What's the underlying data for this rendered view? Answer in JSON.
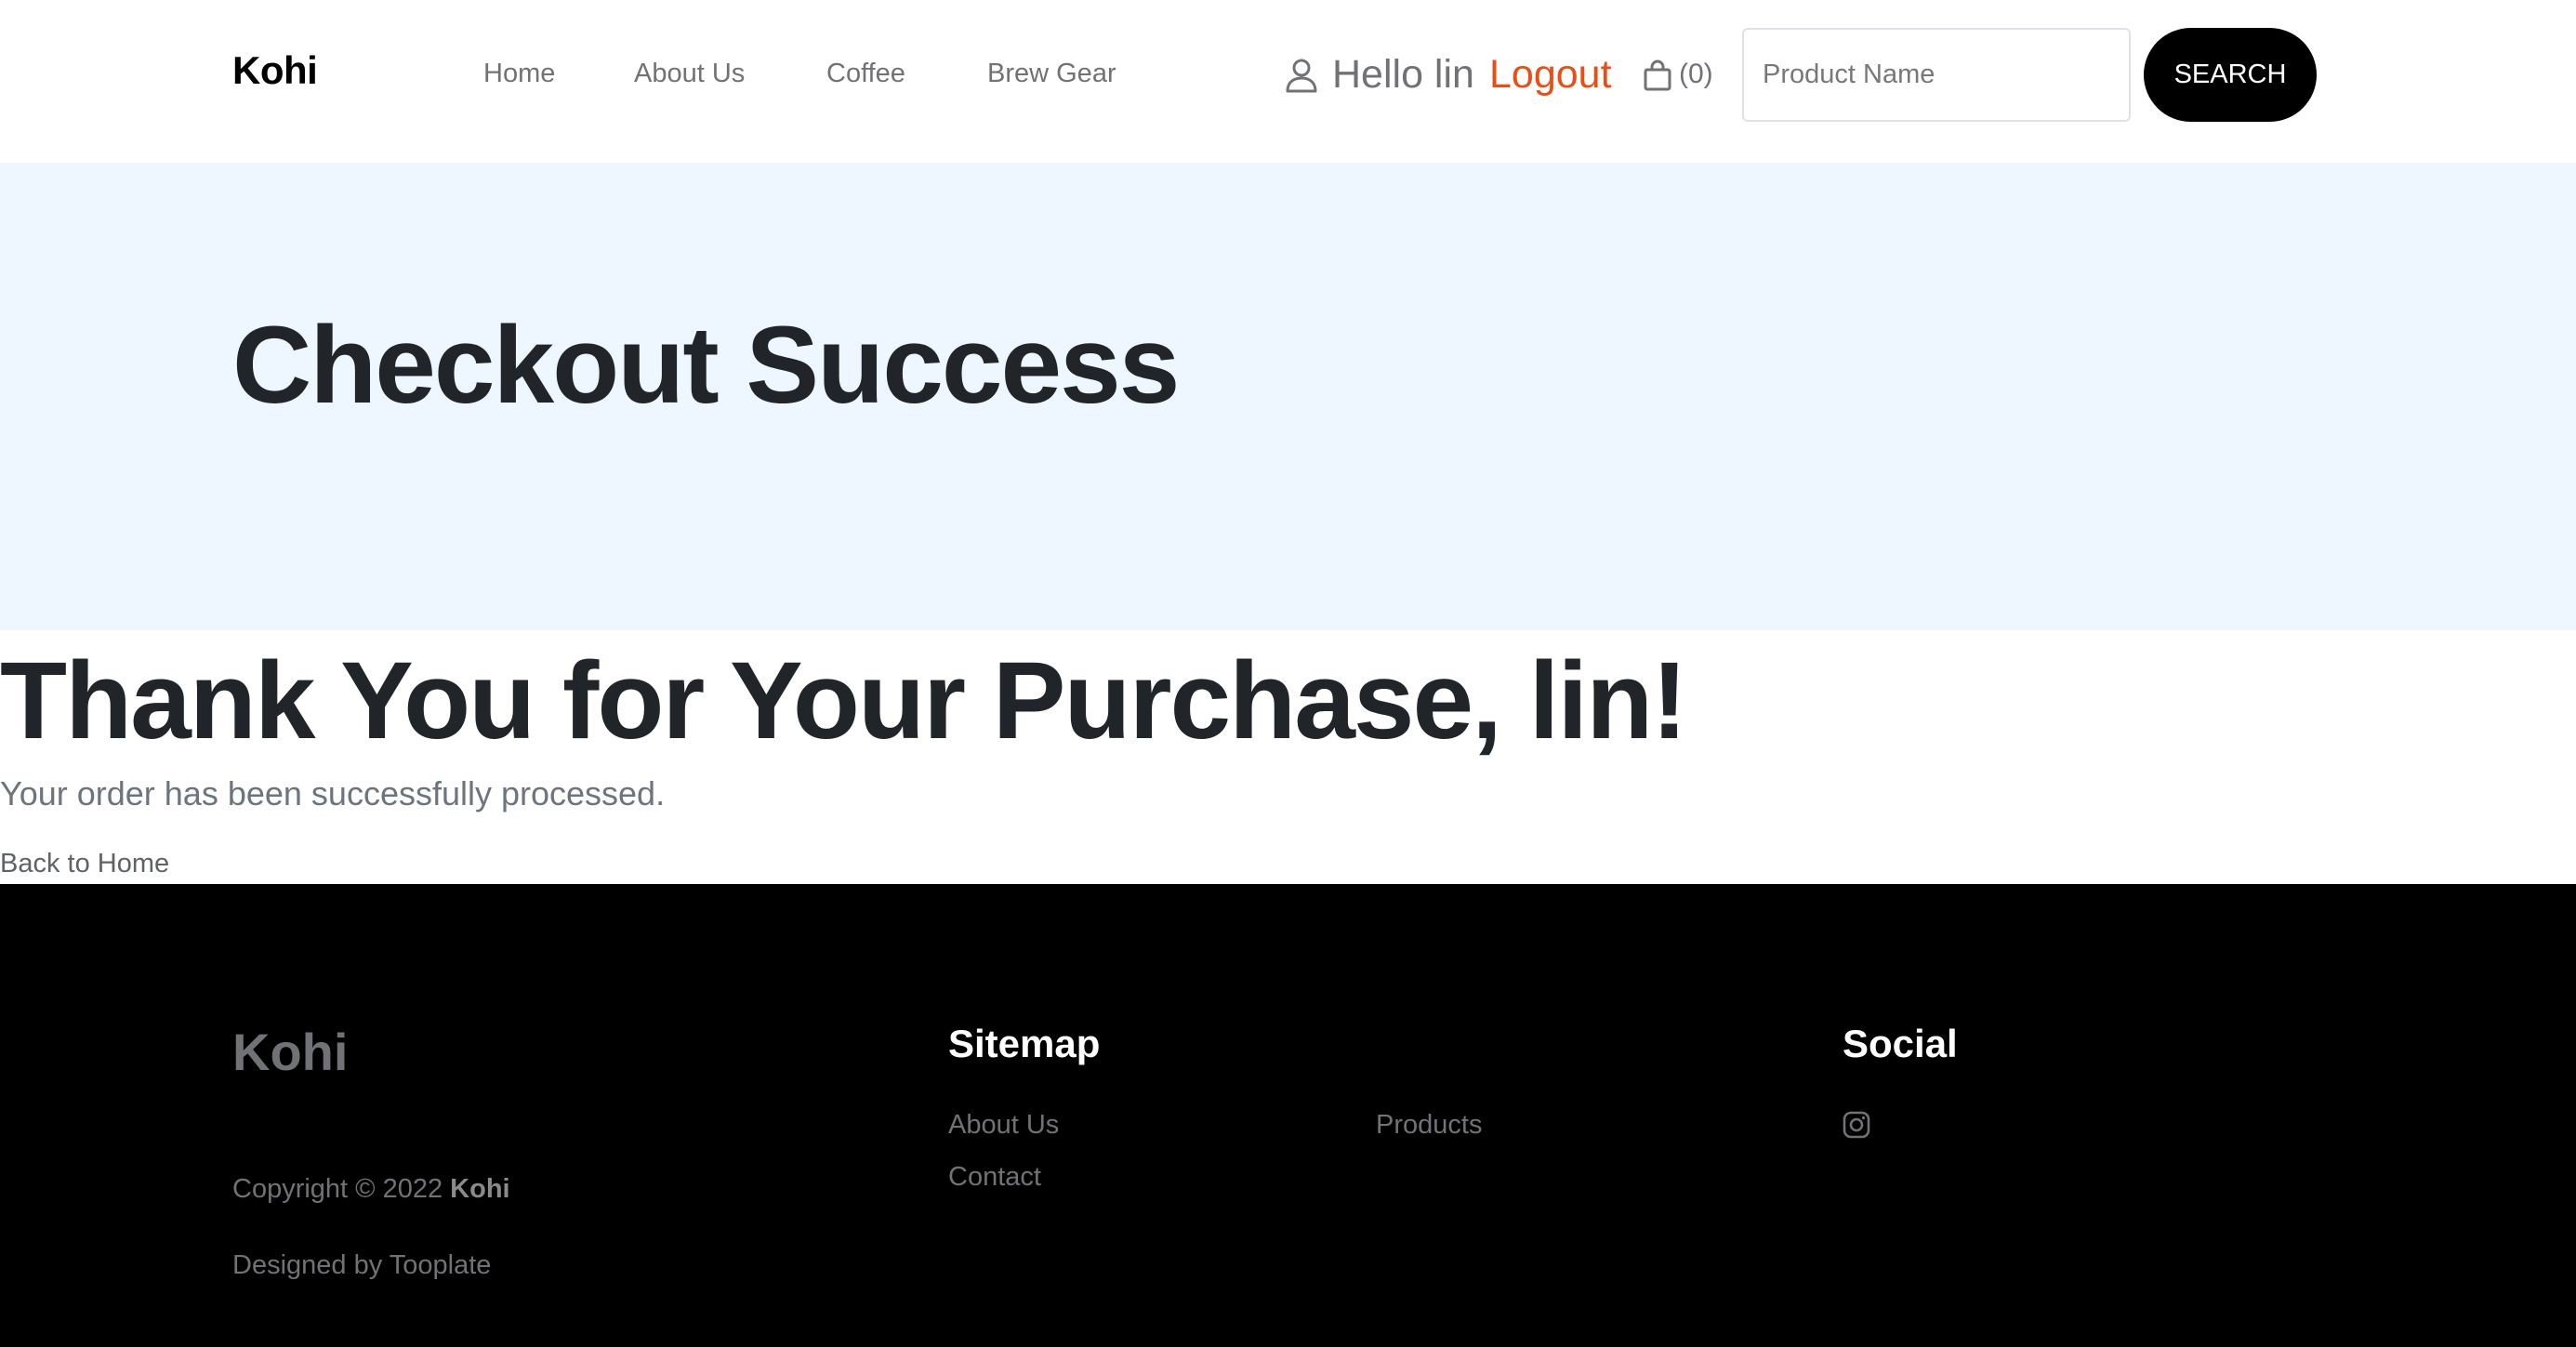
{
  "header": {
    "brand": "Kohi",
    "nav": [
      "Home",
      "About Us",
      "Coffee",
      "Brew Gear"
    ],
    "greeting": "Hello lin",
    "logout": "Logout",
    "cart_count": "(0)",
    "search_placeholder": "Product Name",
    "search_button": "SEARCH"
  },
  "hero": {
    "title": "Checkout Success"
  },
  "content": {
    "heading": "Thank You for Your Purchase, lin!",
    "message": "Your order has been successfully processed.",
    "back_link": "Back to Home"
  },
  "footer": {
    "brand": "Kohi",
    "copyright_prefix": "Copyright © 2022",
    "copyright_brand": "Kohi",
    "designed_by": "Designed by Tooplate",
    "sitemap_title": "Sitemap",
    "sitemap_links": [
      "About Us",
      "Contact",
      "Products"
    ],
    "social_title": "Social",
    "social_icons": [
      "instagram-icon"
    ]
  },
  "colors": {
    "accent": "#e94e16",
    "hero_bg": "#eef7ff",
    "footer_bg": "#000000",
    "button_bg": "#000000"
  },
  "icons": [
    "user-icon",
    "shopping-bag-icon",
    "instagram-icon"
  ]
}
